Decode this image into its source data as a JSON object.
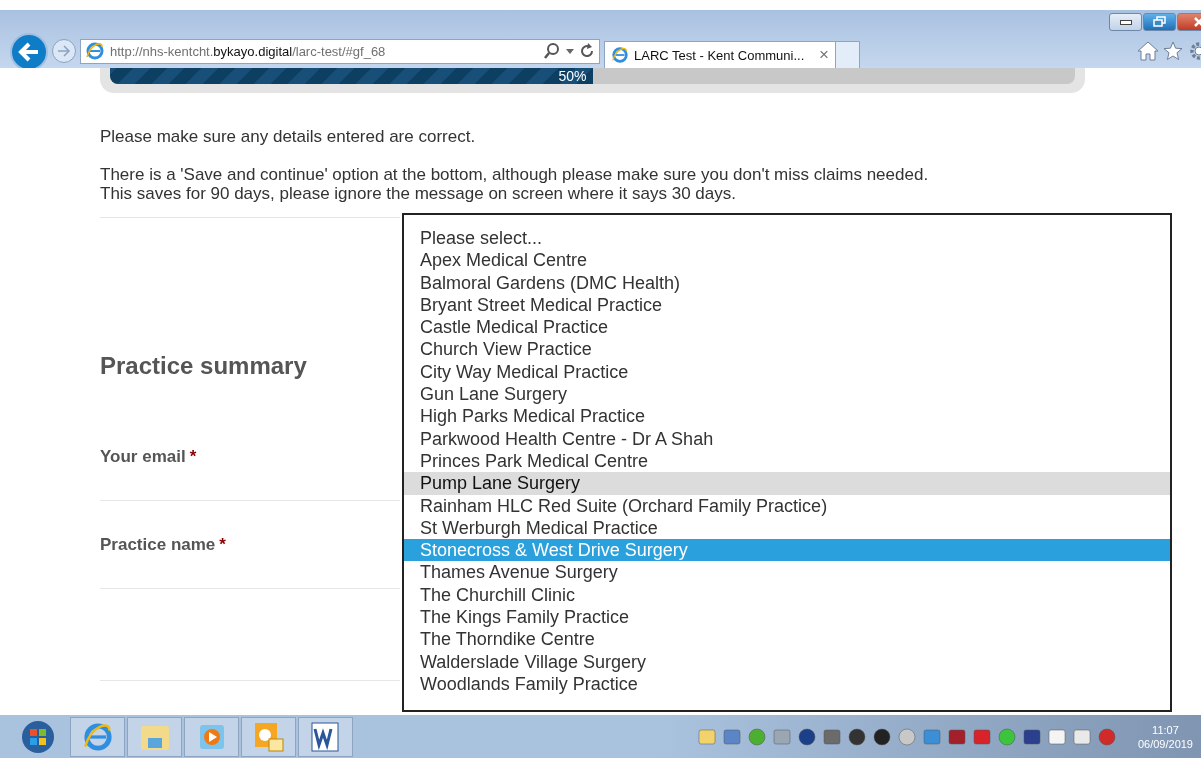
{
  "browser": {
    "address": "http://nhs-kentcht.**bykayo.digital**/larc-test/#gf_68",
    "tab": {
      "title": "LARC Test - Kent Communi...",
      "close": "×",
      "selected": true
    }
  },
  "progress": {
    "level": 0.5,
    "label": "50%"
  },
  "notes": [
    {
      "lines": [
        "Please make sure any details entered are correct."
      ]
    },
    {
      "lines": [
        "There is a 'Save and continue' option at the bottom, although please make sure you don't miss claims needed.",
        "This saves for 90 days, please ignore the message on screen where it says 30 days."
      ]
    }
  ],
  "section_title": "Practice summary",
  "fields": [
    {
      "label": "Your email",
      "required_mark": "*"
    },
    {
      "label": "Practice name",
      "required_mark": "*"
    }
  ],
  "dropdown": {
    "options": [
      {
        "label": "Please select...",
        "hovered": false,
        "selected": false
      },
      {
        "label": "Apex Medical Centre",
        "hovered": false,
        "selected": false
      },
      {
        "label": "Balmoral Gardens (DMC Health)",
        "hovered": false,
        "selected": false
      },
      {
        "label": "Bryant Street Medical Practice",
        "hovered": false,
        "selected": false
      },
      {
        "label": "Castle Medical Practice",
        "hovered": false,
        "selected": false
      },
      {
        "label": "Church View Practice",
        "hovered": false,
        "selected": false
      },
      {
        "label": "City Way Medical Practice",
        "hovered": false,
        "selected": false
      },
      {
        "label": "Gun Lane Surgery",
        "hovered": false,
        "selected": false
      },
      {
        "label": "High Parks Medical Practice",
        "hovered": false,
        "selected": false
      },
      {
        "label": "Parkwood Health Centre - Dr A Shah",
        "hovered": false,
        "selected": false
      },
      {
        "label": "Princes Park Medical Centre",
        "hovered": false,
        "selected": false
      },
      {
        "label": "Pump Lane Surgery",
        "hovered": true,
        "selected": false
      },
      {
        "label": "Rainham HLC Red Suite (Orchard Family Practice)",
        "hovered": false,
        "selected": false
      },
      {
        "label": "St Werburgh Medical Practice",
        "hovered": false,
        "selected": false
      },
      {
        "label": "Stonecross & West Drive Surgery",
        "hovered": false,
        "selected": true
      },
      {
        "label": "Thames Avenue Surgery",
        "hovered": false,
        "selected": false
      },
      {
        "label": "The Churchill Clinic",
        "hovered": false,
        "selected": false
      },
      {
        "label": "The Kings Family Practice",
        "hovered": false,
        "selected": false
      },
      {
        "label": "The Thorndike Centre",
        "hovered": false,
        "selected": false
      },
      {
        "label": "Walderslade Village Surgery",
        "hovered": false,
        "selected": false
      },
      {
        "label": "Woodlands Family Practice",
        "hovered": false,
        "selected": false
      }
    ]
  },
  "taskbar": {
    "apps": [
      {
        "kind": "browser"
      },
      {
        "kind": "folder"
      },
      {
        "kind": "media"
      },
      {
        "kind": "mail"
      },
      {
        "kind": "word"
      }
    ],
    "time": "11:07",
    "date": "06/09/2019"
  }
}
